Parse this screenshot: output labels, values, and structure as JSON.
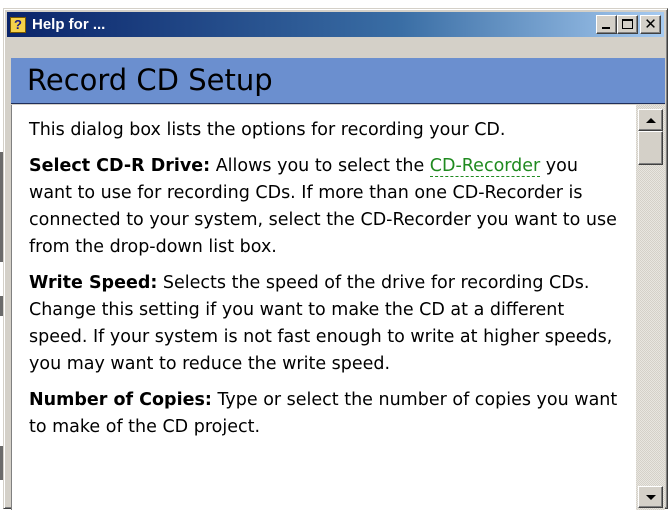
{
  "window": {
    "title": "Help for ...",
    "app_icon_glyph": "?",
    "minimize_icon": "minimize-icon",
    "restore_icon": "restore-icon",
    "close_icon": "close-icon",
    "close_glyph": "✕"
  },
  "topic": {
    "heading": "Record CD Setup",
    "intro": "This dialog box lists the options for recording your CD.",
    "sections": [
      {
        "term": "Select CD-R Drive:",
        "text_before_link": " Allows you to select the ",
        "link": "CD-Recorder",
        "text_after_link": " you want to use for recording CDs. If more than one CD-Recorder is connected to your system, select the CD-Recorder you want to use from the drop-down list box."
      },
      {
        "term": "Write Speed:",
        "text": " Selects the speed of the drive for recording CDs. Change this setting if you want to make the CD at a different speed. If your system is not fast enough to write at higher speeds, you may want to reduce the write speed."
      },
      {
        "term": "Number of Copies:",
        "text": " Type or select the number of copies you want to make of the CD project."
      }
    ]
  },
  "colors": {
    "titlebar_start": "#0a246a",
    "titlebar_end": "#a6caf0",
    "heading_bar": "#6b8fcf",
    "glossary_link": "#1f8a1f"
  }
}
